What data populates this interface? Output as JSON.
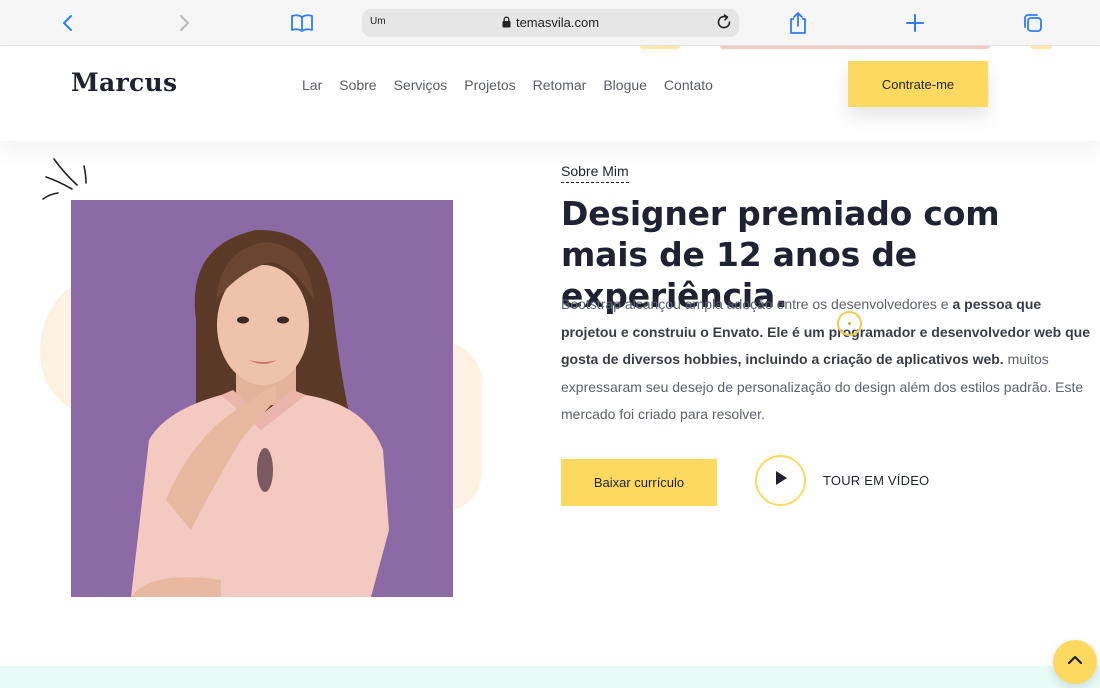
{
  "browser": {
    "tab_hint": "Um",
    "url": "temasvila.com"
  },
  "header": {
    "logo": "Marcus",
    "nav": [
      "Lar",
      "Sobre",
      "Serviços",
      "Projetos",
      "Retomar",
      "Blogue",
      "Contato"
    ],
    "cta": "Contrate-me"
  },
  "hero": {
    "eyebrow": "Sobre Mim",
    "title": "Designer premiado com mais de 12 anos de experiência.",
    "para_start": "Bootstrap alcançou ampla adoção entre os desenvolvedores e ",
    "para_bold": "a pessoa que projetou e construiu o Envato. Ele é um programador e desenvolvedor web que gosta de diversos hobbies, incluindo a criação de aplicativos web.",
    "para_end": " muitos expressaram seu desejo de personalização do design além dos estilos padrão. Este mercado foi criado para resolver.",
    "download_label": "Baixar currículo",
    "video_label": "TOUR EM VÍDEO"
  },
  "colors": {
    "accent": "#fdd95f",
    "photo_bg": "#8c6aa5",
    "text_dark": "#1f2230",
    "text_muted": "#5d6070",
    "blob": "#fdf2e2",
    "next_section_bg": "#e9fbf9"
  },
  "icons": {
    "back": "chevron-left-icon",
    "forward": "chevron-right-icon",
    "bookmarks": "book-icon",
    "lock": "lock-icon",
    "reload": "reload-icon",
    "share": "share-icon",
    "new_tab": "plus-icon",
    "tabs": "tabs-icon",
    "play": "play-icon",
    "scroll_top": "chevron-up-icon"
  }
}
